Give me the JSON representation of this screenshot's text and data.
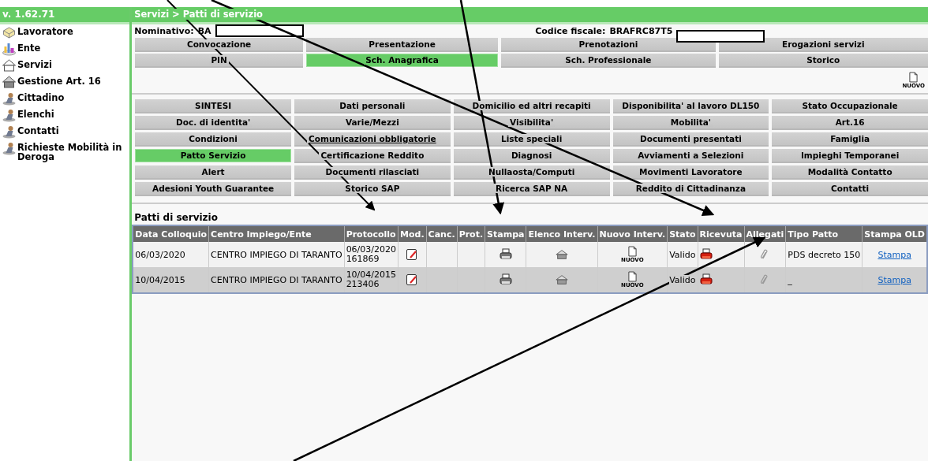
{
  "header": {
    "version": "v. 1.62.71",
    "breadcrumb": "Servizi > Patti di servizio"
  },
  "sidebar": {
    "items": [
      {
        "label": "Lavoratore"
      },
      {
        "label": "Ente"
      },
      {
        "label": "Servizi"
      },
      {
        "label": "Gestione Art. 16"
      },
      {
        "label": "Cittadino"
      },
      {
        "label": "Elenchi"
      },
      {
        "label": "Contatti"
      },
      {
        "label": "Richieste Mobilità in Deroga"
      }
    ]
  },
  "person": {
    "nominativo_label": "Nominativo:",
    "nominativo_value": "BA",
    "codice_fiscale_label": "Codice fiscale:",
    "codice_fiscale_value": "BRAFRC87T5"
  },
  "top_tabs": [
    {
      "label": "Convocazione",
      "selected": false
    },
    {
      "label": "Presentazione",
      "selected": false
    },
    {
      "label": "Prenotazioni",
      "selected": false
    },
    {
      "label": "Erogazioni servizi",
      "selected": false
    },
    {
      "label": "PIN",
      "selected": false
    },
    {
      "label": "Sch. Anagrafica",
      "selected": true
    },
    {
      "label": "Sch. Professionale",
      "selected": false
    },
    {
      "label": "Storico",
      "selected": false
    }
  ],
  "new_button": {
    "label": "NUOVO"
  },
  "sections": [
    {
      "label": "SINTESI",
      "selected": false,
      "underlined": false
    },
    {
      "label": "Dati personali",
      "selected": false,
      "underlined": false
    },
    {
      "label": "Domicilio ed altri recapiti",
      "selected": false,
      "underlined": false
    },
    {
      "label": "Disponibilita' al lavoro DL150",
      "selected": false,
      "underlined": false
    },
    {
      "label": "Stato Occupazionale",
      "selected": false,
      "underlined": false
    },
    {
      "label": "Doc. di identita'",
      "selected": false,
      "underlined": false
    },
    {
      "label": "Varie/Mezzi",
      "selected": false,
      "underlined": false
    },
    {
      "label": "Visibilita'",
      "selected": false,
      "underlined": false
    },
    {
      "label": "Mobilita'",
      "selected": false,
      "underlined": false
    },
    {
      "label": "Art.16",
      "selected": false,
      "underlined": false
    },
    {
      "label": "Condizioni",
      "selected": false,
      "underlined": false
    },
    {
      "label": "Comunicazioni obbligatorie",
      "selected": false,
      "underlined": true
    },
    {
      "label": "Liste speciali",
      "selected": false,
      "underlined": false
    },
    {
      "label": "Documenti presentati",
      "selected": false,
      "underlined": false
    },
    {
      "label": "Famiglia",
      "selected": false,
      "underlined": false
    },
    {
      "label": "Patto Servizio",
      "selected": true,
      "underlined": false
    },
    {
      "label": "Certificazione Reddito",
      "selected": false,
      "underlined": false
    },
    {
      "label": "Diagnosi",
      "selected": false,
      "underlined": false
    },
    {
      "label": "Avviamenti a Selezioni",
      "selected": false,
      "underlined": false
    },
    {
      "label": "Impieghi Temporanei",
      "selected": false,
      "underlined": false
    },
    {
      "label": "Alert",
      "selected": false,
      "underlined": false
    },
    {
      "label": "Documenti rilasciati",
      "selected": false,
      "underlined": false
    },
    {
      "label": "Nullaosta/Computi",
      "selected": false,
      "underlined": false
    },
    {
      "label": "Movimenti Lavoratore",
      "selected": false,
      "underlined": false
    },
    {
      "label": "Modalità Contatto",
      "selected": false,
      "underlined": false
    },
    {
      "label": "Adesioni Youth Guarantee",
      "selected": false,
      "underlined": false
    },
    {
      "label": "Storico SAP",
      "selected": false,
      "underlined": false
    },
    {
      "label": "Ricerca SAP NA",
      "selected": false,
      "underlined": false
    },
    {
      "label": "Reddito di Cittadinanza",
      "selected": false,
      "underlined": false
    },
    {
      "label": "Contatti",
      "selected": false,
      "underlined": false
    }
  ],
  "table": {
    "title": "Patti di servizio",
    "columns": [
      "Data Colloquio",
      "Centro Impiego/Ente",
      "Protocollo",
      "Mod.",
      "Canc.",
      "Prot.",
      "Stampa",
      "Elenco Interv.",
      "Nuovo Interv.",
      "Stato",
      "Ricevuta",
      "Allegati",
      "Tipo Patto",
      "Stampa OLD"
    ],
    "rows": [
      {
        "data_colloquio": "06/03/2020",
        "centro": "CENTRO IMPIEGO DI TARANTO",
        "protocollo_date": "06/03/2020",
        "protocollo_number": "161869",
        "nuovo_label": "NUOVO",
        "stato": "Valido",
        "tipo_patto": "PDS decreto 150",
        "stampa_old": "Stampa"
      },
      {
        "data_colloquio": "10/04/2015",
        "centro": "CENTRO IMPIEGO DI TARANTO",
        "protocollo_date": "10/04/2015",
        "protocollo_number": "213406",
        "nuovo_label": "NUOVO",
        "stato": "Valido",
        "tipo_patto": "_",
        "stampa_old": "Stampa"
      }
    ]
  }
}
